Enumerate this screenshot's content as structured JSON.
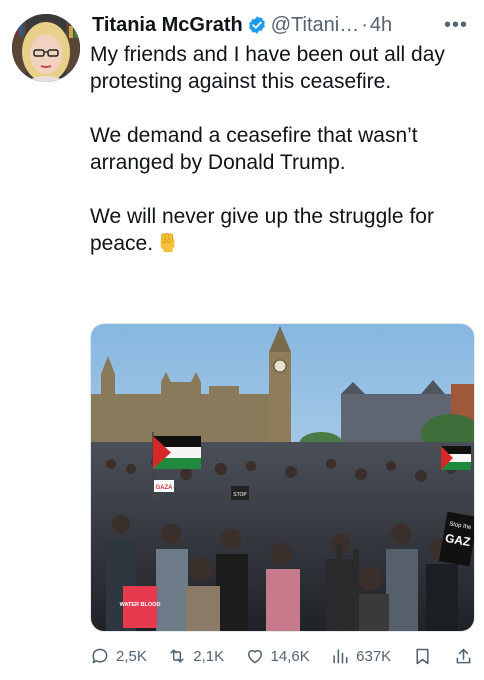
{
  "post": {
    "author_name": "Titania McGrath",
    "handle": "@Titani…",
    "separator": "·",
    "time": "4h",
    "more_icon": "more-icon",
    "verified_icon": "verified-badge-icon",
    "paragraphs": [
      "My friends and I have been out all day protesting against this ceasefire.",
      "We demand a ceasefire that wasn’t arranged by Donald Trump.",
      "We will never give up the struggle for peace."
    ],
    "emoji": "raised-fist-emoji",
    "photo": {
      "description_icon": "protest-photo",
      "signs": [
        "GAZA",
        "Stop the",
        "GAZ",
        "STOP",
        "WATER BLOOD"
      ]
    }
  },
  "actions": {
    "replies": "2,5K",
    "reposts": "2,1K",
    "likes": "14,6K",
    "views": "637K"
  },
  "colors": {
    "text": "#0f1419",
    "secondary": "#536471",
    "verified": "#1d9bf0"
  }
}
